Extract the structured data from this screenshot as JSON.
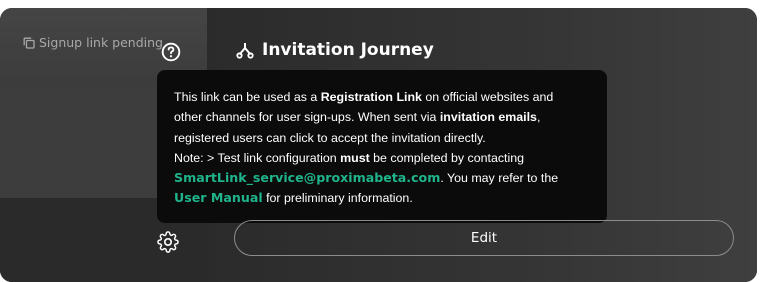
{
  "status": {
    "pending_label": "Signup link pending",
    "copy_icon": "copy-icon"
  },
  "help": {
    "icon": "help-circle-icon"
  },
  "journey": {
    "title": "Invitation Journey",
    "icon": "branch-icon"
  },
  "tooltip": {
    "l1_a": "This link can be used as a ",
    "l1_b": "Registration Link",
    "l1_c": " on official websites and",
    "l2_a": "other channels for user sign-ups. When sent via ",
    "l2_b": "invitation emails",
    "l2_c": ",",
    "l3": "registered users can click to accept the invitation directly.",
    "l4_a": "Note: > Test link configuration ",
    "l4_b": "must",
    "l4_c": " be completed by contacting",
    "email": "SmartLink_service@proximabeta.com",
    "l5_c": ". You may refer to the",
    "manual": "User Manual",
    "l6_c": " for preliminary information."
  },
  "settings": {
    "icon": "gear-icon"
  },
  "edit": {
    "label": "Edit"
  }
}
